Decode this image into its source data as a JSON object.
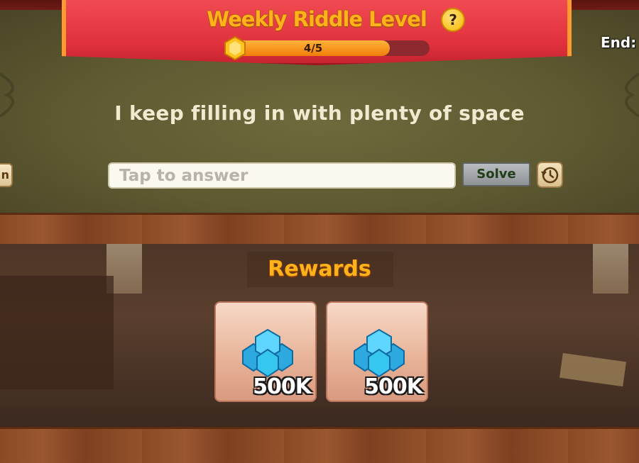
{
  "header": {
    "title": "Weekly Riddle Level",
    "help_label": "?",
    "progress_text": "4/5",
    "progress_value": 0.8,
    "end_label": "End:"
  },
  "riddle": {
    "question": "I keep filling in with plenty of space",
    "answer_placeholder": "Tap to answer",
    "answer_value": "",
    "solve_label": "Solve",
    "left_tab_label": "n"
  },
  "rewards": {
    "title": "Rewards",
    "items": [
      {
        "icon": "blue-gems-icon",
        "amount": "500K"
      },
      {
        "icon": "blue-gems-icon",
        "amount": "500K"
      }
    ]
  },
  "colors": {
    "banner": "#e0313d",
    "title_gold": "#ffb21a",
    "board": "#5e5a32",
    "wood": "#8a4a24",
    "gem_blue": "#37c6f0"
  }
}
